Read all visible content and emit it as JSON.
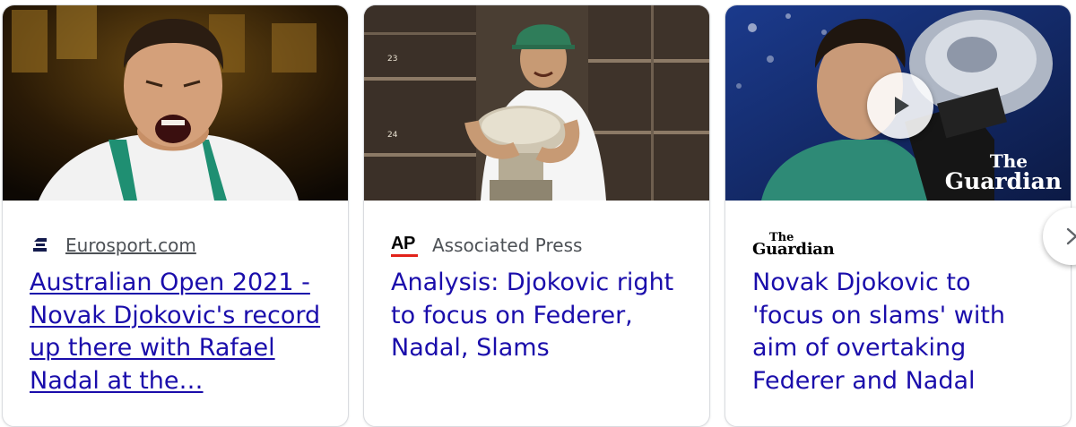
{
  "cards": [
    {
      "source": "Eurosport.com",
      "headline": "Australian Open 2021 - Novak Djokovic's record up there with Rafael Nadal at the…"
    },
    {
      "source": "Associated Press",
      "logo_text": "AP",
      "headline": "Analysis: Djokovic right to focus on Federer, Nadal, Slams",
      "locker_numbers": [
        "23",
        "24"
      ]
    },
    {
      "logo_text": "The Guardian",
      "headline": "Novak Djokovic to 'focus on slams' with aim of overtaking Federer and Nadal",
      "watermark_the": "The",
      "watermark_main": "Guardian"
    }
  ],
  "colors": {
    "link": "#1a0dab",
    "source_text": "#4d5156",
    "card_border": "#dadce0",
    "ap_red": "#e2231a"
  },
  "icons": {
    "card1_logo": "eurosport-logo",
    "card3_media": "play-icon",
    "carousel_next": "chevron-right-icon"
  }
}
